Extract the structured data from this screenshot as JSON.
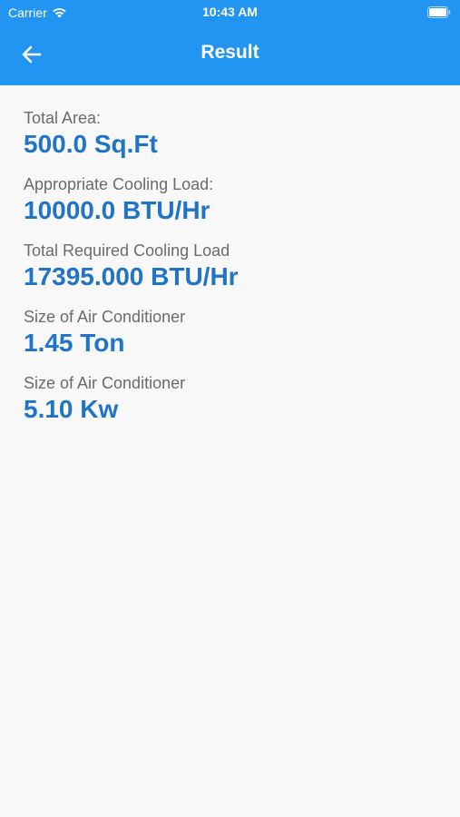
{
  "status_bar": {
    "carrier": "Carrier",
    "time": "10:43 AM"
  },
  "nav": {
    "title": "Result"
  },
  "results": [
    {
      "label": "Total Area:",
      "value": "500.0 Sq.Ft"
    },
    {
      "label": "Appropriate Cooling Load:",
      "value": "10000.0 BTU/Hr"
    },
    {
      "label": "Total Required Cooling Load",
      "value": "17395.000 BTU/Hr"
    },
    {
      "label": "Size of Air Conditioner",
      "value": "1.45 Ton"
    },
    {
      "label": "Size of Air Conditioner",
      "value": "5.10 Kw"
    }
  ],
  "colors": {
    "header_bg": "#2295f2",
    "value_text": "#1f74c8",
    "label_text": "#6b6b6b",
    "page_bg": "#f8f8f8"
  }
}
